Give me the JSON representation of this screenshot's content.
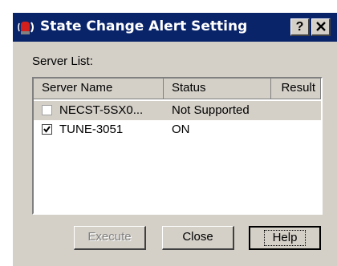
{
  "window": {
    "title": "State Change Alert Setting",
    "help_button": "?",
    "close_button": "✕"
  },
  "server_list": {
    "label": "Server List:",
    "columns": [
      "Server Name",
      "Status",
      "Result"
    ],
    "rows": [
      {
        "name": "NECST-5SX0...",
        "status": "Not Supported",
        "result": "",
        "checked": false,
        "enabled": false,
        "selected": true
      },
      {
        "name": "TUNE-3051",
        "status": "ON",
        "result": "",
        "checked": true,
        "enabled": true,
        "selected": false
      }
    ]
  },
  "buttons": {
    "execute": "Execute",
    "close": "Close",
    "help": "Help"
  },
  "colors": {
    "titlebar": "#0a246a",
    "face": "#d4d0c8"
  }
}
